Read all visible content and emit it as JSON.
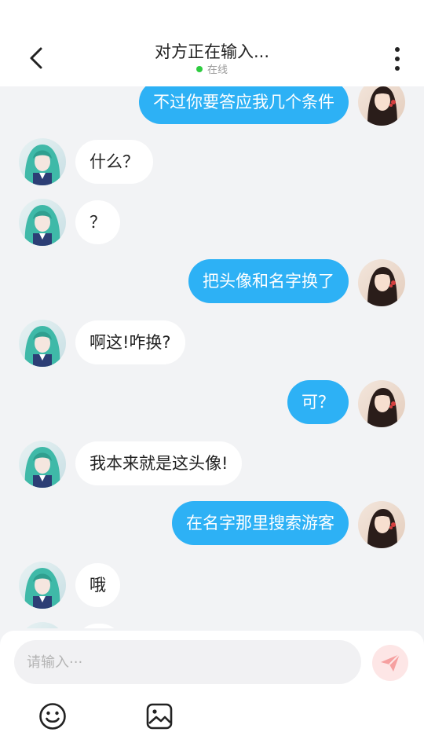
{
  "header": {
    "title": "对方正在输入...",
    "status": "在线"
  },
  "messages": [
    {
      "side": "out",
      "text": "不过你要答应我几个条件"
    },
    {
      "side": "in",
      "text": "什么？"
    },
    {
      "side": "in",
      "text": "？"
    },
    {
      "side": "out",
      "text": "把头像和名字换了"
    },
    {
      "side": "in",
      "text": "啊这!咋换?"
    },
    {
      "side": "out",
      "text": "可？"
    },
    {
      "side": "in",
      "text": "我本来就是这头像!"
    },
    {
      "side": "out",
      "text": "在名字那里搜索游客"
    },
    {
      "side": "in",
      "text": "哦"
    },
    {
      "side": "in",
      "text": ""
    }
  ],
  "composer": {
    "placeholder": "请输入···"
  },
  "icons": {
    "back": "chevron-left-icon",
    "more": "more-vertical-icon",
    "send": "send-icon",
    "emoji": "emoji-icon",
    "image": "image-icon"
  },
  "colors": {
    "accent": "#2db1f5",
    "online": "#2ecc40",
    "send_bg": "#fde6e6",
    "send_fg": "#f6a0a0"
  }
}
